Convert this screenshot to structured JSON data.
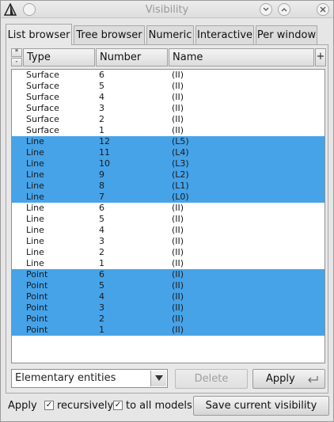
{
  "window": {
    "title": "Visibility",
    "icons": [
      "gmsh-logo-icon",
      "menu-circle-icon",
      "minimize-icon",
      "maximize-icon",
      "close-icon"
    ]
  },
  "tabs": [
    {
      "label": "List browser",
      "active": true
    },
    {
      "label": "Tree browser",
      "active": false
    },
    {
      "label": "Numeric",
      "active": false
    },
    {
      "label": "Interactive",
      "active": false
    },
    {
      "label": "Per window",
      "active": false
    }
  ],
  "table": {
    "star_label": "*",
    "minus_label": "-",
    "plus_label": "+",
    "columns": [
      "Type",
      "Number",
      "Name"
    ],
    "rows": [
      {
        "type": "Surface",
        "number": "6",
        "name": "(II)",
        "selected": false
      },
      {
        "type": "Surface",
        "number": "5",
        "name": "(II)",
        "selected": false
      },
      {
        "type": "Surface",
        "number": "4",
        "name": "(II)",
        "selected": false
      },
      {
        "type": "Surface",
        "number": "3",
        "name": "(II)",
        "selected": false
      },
      {
        "type": "Surface",
        "number": "2",
        "name": "(II)",
        "selected": false
      },
      {
        "type": "Surface",
        "number": "1",
        "name": "(II)",
        "selected": false
      },
      {
        "type": "Line",
        "number": "12",
        "name": "(L5)",
        "selected": true
      },
      {
        "type": "Line",
        "number": "11",
        "name": "(L4)",
        "selected": true
      },
      {
        "type": "Line",
        "number": "10",
        "name": "(L3)",
        "selected": true
      },
      {
        "type": "Line",
        "number": "9",
        "name": "(L2)",
        "selected": true
      },
      {
        "type": "Line",
        "number": "8",
        "name": "(L1)",
        "selected": true
      },
      {
        "type": "Line",
        "number": "7",
        "name": "(L0)",
        "selected": true
      },
      {
        "type": "Line",
        "number": "6",
        "name": "(II)",
        "selected": false
      },
      {
        "type": "Line",
        "number": "5",
        "name": "(II)",
        "selected": false
      },
      {
        "type": "Line",
        "number": "4",
        "name": "(II)",
        "selected": false
      },
      {
        "type": "Line",
        "number": "3",
        "name": "(II)",
        "selected": false
      },
      {
        "type": "Line",
        "number": "2",
        "name": "(II)",
        "selected": false
      },
      {
        "type": "Line",
        "number": "1",
        "name": "(II)",
        "selected": false
      },
      {
        "type": "Point",
        "number": "6",
        "name": "(II)",
        "selected": true
      },
      {
        "type": "Point",
        "number": "5",
        "name": "(II)",
        "selected": true
      },
      {
        "type": "Point",
        "number": "4",
        "name": "(II)",
        "selected": true
      },
      {
        "type": "Point",
        "number": "3",
        "name": "(II)",
        "selected": true
      },
      {
        "type": "Point",
        "number": "2",
        "name": "(II)",
        "selected": true
      },
      {
        "type": "Point",
        "number": "1",
        "name": "(II)",
        "selected": true
      }
    ]
  },
  "controls": {
    "entity_select_value": "Elementary entities",
    "delete_label": "Delete",
    "apply_label": "Apply"
  },
  "footer": {
    "apply_label": "Apply",
    "recursively_label": "recursively",
    "recursively_checked": true,
    "to_all_models_label": "to all models",
    "to_all_models_checked": true,
    "save_label": "Save current visibility"
  },
  "colors": {
    "selection": "#46a3e8",
    "window_bg": "#e6e6e6"
  }
}
